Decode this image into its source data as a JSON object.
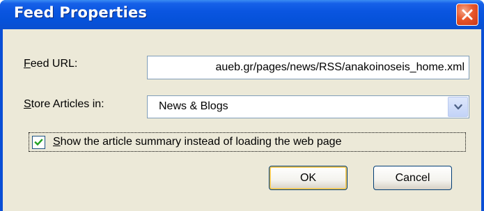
{
  "window": {
    "title": "Feed Properties",
    "close_icon": "close-icon"
  },
  "form": {
    "feed_url_label_accel": "F",
    "feed_url_label_rest": "eed URL:",
    "feed_url_value": "aueb.gr/pages/news/RSS/anakoinoseis_home.xml",
    "store_label_accel": "S",
    "store_label_rest": "tore Articles in:",
    "store_value": "News & Blogs",
    "summary_checked": true,
    "summary_label_accel": "S",
    "summary_label_rest": "how the article summary instead of loading the web page"
  },
  "buttons": {
    "ok": "OK",
    "cancel": "Cancel"
  },
  "colors": {
    "titlebar": "#0a55e0",
    "client_bg": "#ece9d8",
    "close_red": "#e8572a",
    "field_border": "#7f9db9"
  }
}
